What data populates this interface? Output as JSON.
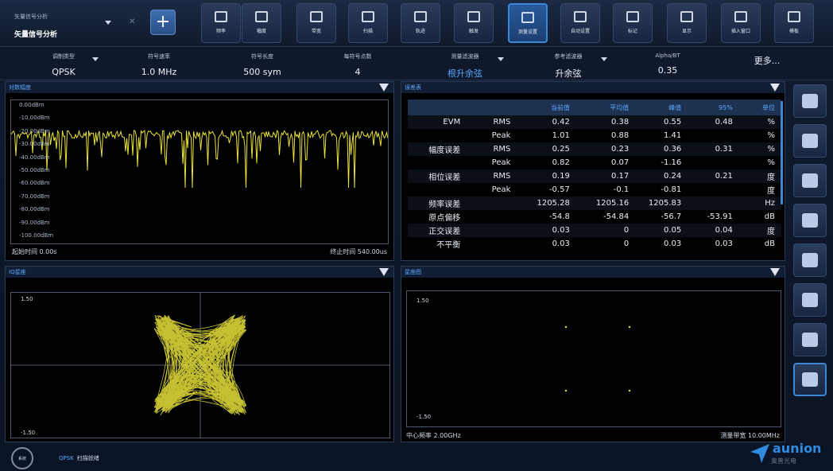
{
  "mode": {
    "caption": "矢量信号分析",
    "value": "矢量信号分析"
  },
  "toolbar": [
    {
      "label": "频率",
      "icon": "frequency-icon"
    },
    {
      "label": "幅度",
      "icon": "amplitude-icon"
    },
    {
      "label": "带宽",
      "icon": "bandwidth-icon"
    },
    {
      "label": "扫描",
      "icon": "sweep-icon"
    },
    {
      "label": "轨迹",
      "icon": "trace-icon"
    },
    {
      "label": "触发",
      "icon": "trigger-icon"
    },
    {
      "label": "测量设置",
      "icon": "measure-setup-icon",
      "active": true
    },
    {
      "label": "自动设置",
      "icon": "auto-setup-icon"
    },
    {
      "label": "标记",
      "icon": "marker-icon"
    },
    {
      "label": "显示",
      "icon": "display-icon"
    },
    {
      "label": "插入窗口",
      "icon": "insert-window-icon"
    },
    {
      "label": "模板",
      "icon": "template-icon"
    }
  ],
  "params": [
    {
      "caption": "调制类型",
      "value": "QPSK",
      "dropdown": true
    },
    {
      "caption": "符号速率",
      "value": "1.0 MHz"
    },
    {
      "caption": "符号长度",
      "value": "500 sym"
    },
    {
      "caption": "每符号点数",
      "value": "4"
    },
    {
      "caption": "测量滤波器",
      "value": "根升余弦",
      "highlight": true,
      "dropdown": true
    },
    {
      "caption": "参考滤波器",
      "value": "升余弦",
      "dropdown": true
    },
    {
      "caption": "Alpha/BT",
      "value": "0.35"
    },
    {
      "caption": "",
      "value": "更多..."
    }
  ],
  "panels": {
    "pa": {
      "title": "对数幅度",
      "ylabels": [
        "0.00dBm",
        "-10.00dBm",
        "-20.00dBm",
        "-30.00dBm",
        "-40.00dBm",
        "-50.00dBm",
        "-60.00dBm",
        "-70.00dBm",
        "-80.00dBm",
        "-90.00dBm",
        "-100.00dBm"
      ],
      "start": "起始时间 0.00s",
      "stop": "终止时间 540.00us"
    },
    "pb": {
      "title": "误差表"
    },
    "pc": {
      "title": "IQ星座",
      "ytop": "1.50",
      "ybottom": "-1.50"
    },
    "pd": {
      "title": "星座图",
      "ytop": "1.50",
      "ybottom": "-1.50",
      "center": "中心频率 2.00GHz",
      "span": "测量带宽 10.00MHz"
    }
  },
  "table": {
    "headers": [
      "",
      "",
      "当前值",
      "平均值",
      "峰值",
      "95%",
      "单位"
    ],
    "rows": [
      [
        "EVM",
        "RMS",
        "0.42",
        "0.38",
        "0.55",
        "0.48",
        "%"
      ],
      [
        "",
        "Peak",
        "1.01",
        "0.88",
        "1.41",
        "",
        "%"
      ],
      [
        "幅度误差",
        "RMS",
        "0.25",
        "0.23",
        "0.36",
        "0.31",
        "%"
      ],
      [
        "",
        "Peak",
        "0.82",
        "0.07",
        "-1.16",
        "",
        "%"
      ],
      [
        "相位误差",
        "RMS",
        "0.19",
        "0.17",
        "0.24",
        "0.21",
        "度"
      ],
      [
        "",
        "Peak",
        "-0.57",
        "-0.1",
        "-0.81",
        "",
        "度"
      ],
      [
        "频率误差",
        "",
        "1205.28",
        "1205.16",
        "1205.83",
        "",
        "Hz"
      ],
      [
        "原点偏移",
        "",
        "-54.8",
        "-54.84",
        "-56.7",
        "-53.91",
        "dB"
      ],
      [
        "正交误差",
        "",
        "0.03",
        "0",
        "0.05",
        "0.04",
        "度"
      ],
      [
        "不平衡",
        "",
        "0.03",
        "0",
        "0.03",
        "0.03",
        "dB"
      ]
    ]
  },
  "sidebar": [
    {
      "icon": "home-icon"
    },
    {
      "icon": "print-icon"
    },
    {
      "icon": "globe-icon"
    },
    {
      "icon": "refresh-icon"
    },
    {
      "icon": "save-icon"
    },
    {
      "icon": "folder-icon"
    },
    {
      "icon": "window-icon"
    },
    {
      "icon": "layout-icon",
      "active": true
    }
  ],
  "status": {
    "home": "系统",
    "tag": "QPSK",
    "text": "扫描就绪"
  },
  "logo": {
    "word": "aunion",
    "sub": "奥普光电"
  },
  "colors": {
    "trace": "#e8e23a",
    "accent": "#3a87d6",
    "label_blue": "#5aa7ff"
  }
}
